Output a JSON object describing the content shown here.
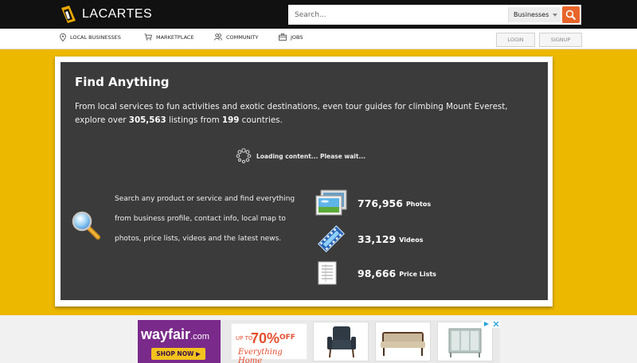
{
  "header": {
    "logo_text": "LACARTES",
    "search": {
      "placeholder": "Search...",
      "category": "Businesses"
    }
  },
  "nav": {
    "items": [
      {
        "label": "LOCAL BUSINESSES",
        "icon": "map-pin-icon"
      },
      {
        "label": "MARKETPLACE",
        "icon": "cart-icon"
      },
      {
        "label": "COMMUNITY",
        "icon": "people-icon"
      },
      {
        "label": "JOBS",
        "icon": "briefcase-icon"
      }
    ],
    "login_label": "LOGIN",
    "signup_label": "SIGNUP"
  },
  "hero": {
    "title": "Find Anything",
    "intro_prefix": "From local services to fun activities and exotic destinations, even tour guides for climbing Mount Everest, explore over ",
    "listings_count": "305,563",
    "intro_middle": " listings from ",
    "countries_count": "199",
    "intro_suffix": " countries.",
    "loading_text": "Loading content... Please wait...",
    "search_description": "Search any product or service and find everything from business profile, contact info, local map to photos, price lists, videos and the latest news.",
    "stats": [
      {
        "number": "776,956",
        "label": "Photos",
        "icon": "photos-icon"
      },
      {
        "number": "33,129",
        "label": "Videos",
        "icon": "film-icon"
      },
      {
        "number": "98,666",
        "label": "Price Lists",
        "icon": "price-list-icon"
      }
    ]
  },
  "ad": {
    "brand": "wayfair",
    "brand_suffix": ".com",
    "cta": "SHOP NOW ▶",
    "promo_upto": "UP TO",
    "promo_pct": "70%",
    "promo_off": "OFF",
    "promo_tagline": "Everything Home"
  },
  "colors": {
    "topbar": "#111111",
    "accent_orange": "#e8652a",
    "hero_yellow": "#ecb800",
    "panel_dark": "#3b3b3b",
    "wayfair_purple": "#7a2a8a"
  }
}
